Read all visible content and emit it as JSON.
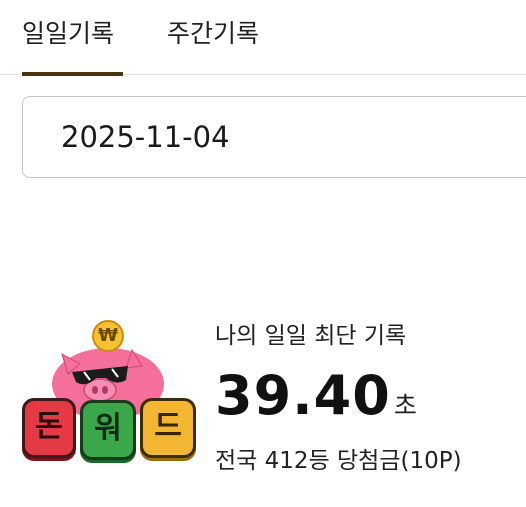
{
  "tabs": [
    {
      "label": "일일기록",
      "active": true
    },
    {
      "label": "주간기록",
      "active": false
    }
  ],
  "date_field": {
    "value": "2025-11-04"
  },
  "logo": {
    "coin_symbol": "₩",
    "tiles": [
      "돈",
      "워",
      "드"
    ],
    "tile_colors": [
      "#e53945",
      "#3aa84a",
      "#f2b632"
    ]
  },
  "record": {
    "label": "나의 일일 최단 기록",
    "time": "39.40",
    "unit": "초",
    "rank": "전국 412등 당첨금(10P)"
  },
  "colors": {
    "tab_indicator": "#4a3410",
    "pig_pink": "#f56f9b"
  }
}
